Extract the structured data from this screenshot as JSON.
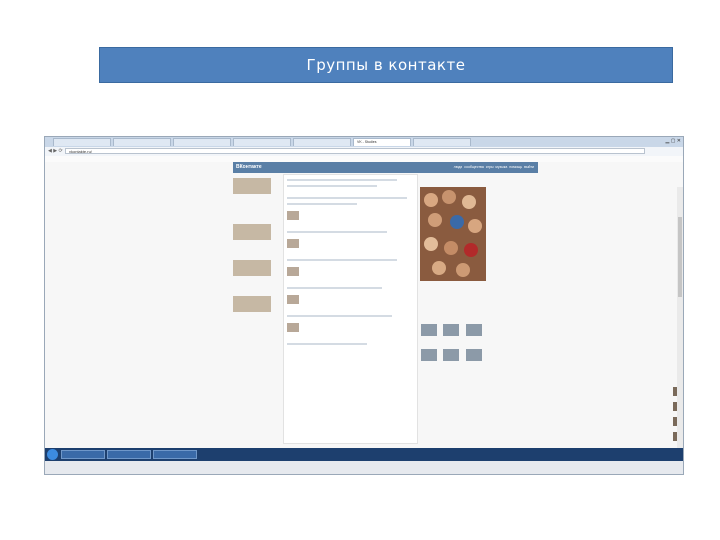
{
  "slide": {
    "title": "Группы в контакте"
  },
  "screenshot": {
    "browser": {
      "tabs": [
        "",
        "",
        "",
        "",
        "",
        "VK - Studies",
        ""
      ],
      "address": "vkontakte.ru/"
    },
    "site": {
      "logo": "ВКонтакте",
      "menu": [
        "люди",
        "сообщества",
        "игры",
        "музыка",
        "помощь",
        "выйти"
      ]
    },
    "taskbar": {
      "items": [
        "",
        "",
        ""
      ],
      "time": ""
    }
  }
}
